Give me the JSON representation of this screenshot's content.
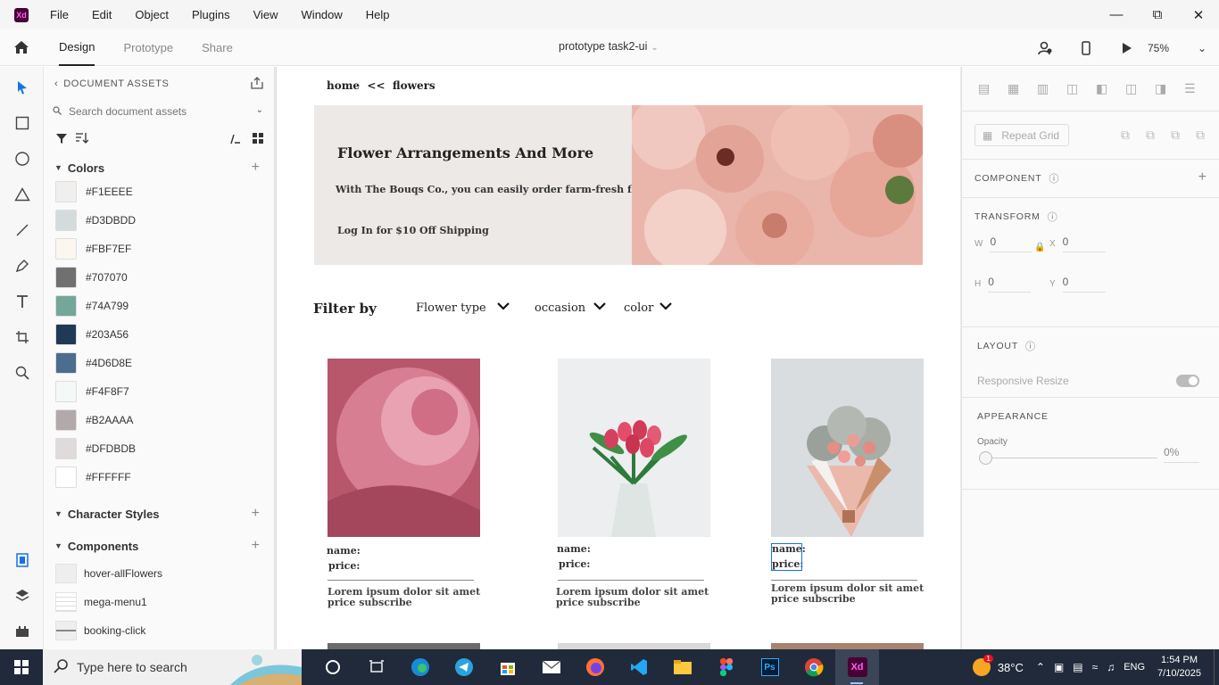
{
  "app": {
    "logo": "Xd",
    "menu": [
      "File",
      "Edit",
      "Object",
      "Plugins",
      "View",
      "Window",
      "Help"
    ],
    "window_controls": [
      "minimize-icon",
      "restore-icon",
      "close-icon"
    ]
  },
  "toolbar": {
    "tabs": [
      {
        "label": "Design",
        "active": true
      },
      {
        "label": "Prototype",
        "active": false
      },
      {
        "label": "Share",
        "active": false
      }
    ],
    "document_title": "prototype task2-ui",
    "zoom": "75%"
  },
  "assets": {
    "header": "DOCUMENT ASSETS",
    "search_placeholder": "Search document assets",
    "sections": {
      "colors": "Colors",
      "character_styles": "Character Styles",
      "components": "Components"
    },
    "colors": [
      {
        "hex": "#F1EEEE"
      },
      {
        "hex": "#D3DBDD"
      },
      {
        "hex": "#FBF7EF"
      },
      {
        "hex": "#707070"
      },
      {
        "hex": "#74A799"
      },
      {
        "hex": "#203A56"
      },
      {
        "hex": "#4D6D8E"
      },
      {
        "hex": "#F4F8F7"
      },
      {
        "hex": "#B2AAAA"
      },
      {
        "hex": "#DFDBDB"
      },
      {
        "hex": "#FFFFFF"
      }
    ],
    "components": [
      {
        "label": "hover-allFlowers"
      },
      {
        "label": "mega-menu1"
      },
      {
        "label": "booking-click"
      }
    ]
  },
  "artboard": {
    "breadcrumb": "home  <<  flowers",
    "hero": {
      "title": "Flower Arrangements And More",
      "subtitle": "With The Bouqs Co., you can easily order farm-fresh flo,",
      "cta": "Log In for $10 Off Shipping"
    },
    "filter": {
      "label": "Filter by",
      "options": [
        "Flower type",
        "occasion",
        "color"
      ]
    },
    "cards": [
      {
        "name": "name:",
        "price": "price:",
        "desc": "Lorem ipsum dolor sit amet price subscribe"
      },
      {
        "name": "name:",
        "price": "price:",
        "desc": "Lorem ipsum dolor sit amet price subscribe"
      },
      {
        "name": "name:",
        "price": "price:",
        "desc": "Lorem ipsum dolor sit amet price subscribe"
      }
    ]
  },
  "properties": {
    "repeat_grid": "Repeat Grid",
    "component": "COMPONENT",
    "transform": "TRANSFORM",
    "w_label": "W",
    "w": "0",
    "x_label": "X",
    "x": "0",
    "h_label": "H",
    "h": "0",
    "y_label": "Y",
    "y": "0",
    "layout": "LAYOUT",
    "responsive_resize": "Responsive Resize",
    "appearance": "APPEARANCE",
    "opacity_label": "Opacity",
    "opacity": "0%"
  },
  "taskbar": {
    "search_placeholder": "Type here to search",
    "weather_badge": "1",
    "temperature": "38°C",
    "language": "ENG",
    "time": "1:54 PM",
    "date": "7/10/2025"
  },
  "colors": {
    "accent": "#1473e6",
    "xd_brand": "#470137",
    "xd_pink": "#ff61f6",
    "taskbar": "#202a3a"
  }
}
